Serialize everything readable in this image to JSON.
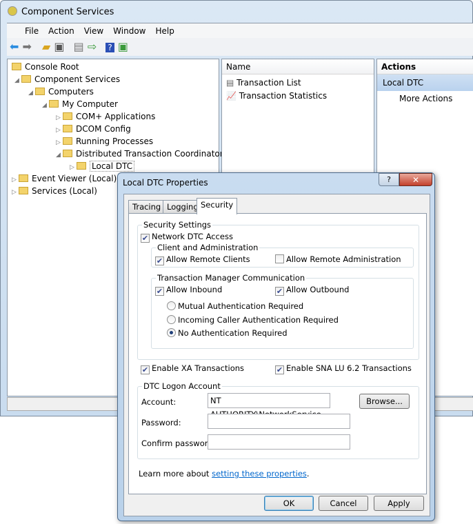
{
  "window": {
    "title": "Component Services"
  },
  "menu": [
    "File",
    "Action",
    "View",
    "Window",
    "Help"
  ],
  "tree": [
    {
      "label": "Console Root",
      "level": 0,
      "twisty": ""
    },
    {
      "label": "Component Services",
      "level": 1,
      "twisty": "▲"
    },
    {
      "label": "Computers",
      "level": 2,
      "twisty": "▲"
    },
    {
      "label": "My Computer",
      "level": 3,
      "twisty": "▲"
    },
    {
      "label": "COM+ Applications",
      "level": 4,
      "twisty": "▷"
    },
    {
      "label": "DCOM Config",
      "level": 4,
      "twisty": "▷"
    },
    {
      "label": "Running Processes",
      "level": 4,
      "twisty": "▷"
    },
    {
      "label": "Distributed Transaction Coordinator",
      "level": 4,
      "twisty": "▲"
    },
    {
      "label": "Local DTC",
      "level": 5,
      "twisty": "▷"
    },
    {
      "label": "Event Viewer (Local)",
      "level": 0,
      "twisty": "▷"
    },
    {
      "label": "Services (Local)",
      "level": 0,
      "twisty": "▷"
    }
  ],
  "list": {
    "header": "Name",
    "items": [
      "Transaction List",
      "Transaction Statistics"
    ]
  },
  "actions": {
    "header": "Actions",
    "selected": "Local DTC",
    "items": [
      "More Actions"
    ]
  },
  "dialog": {
    "title": "Local DTC Properties",
    "tabs": [
      "Tracing",
      "Logging",
      "Security"
    ],
    "security_settings": "Security Settings",
    "network_dtc_access": "Network DTC Access",
    "client_admin": "Client and Administration",
    "allow_remote_clients": "Allow Remote Clients",
    "allow_remote_admin": "Allow Remote Administration",
    "tm_comm": "Transaction Manager Communication",
    "allow_inbound": "Allow Inbound",
    "allow_outbound": "Allow Outbound",
    "radio_mutual": "Mutual Authentication Required",
    "radio_incoming": "Incoming Caller Authentication Required",
    "radio_none": "No Authentication Required",
    "enable_xa": "Enable XA Transactions",
    "enable_sna": "Enable SNA LU 6.2 Transactions",
    "logon_account": "DTC Logon Account",
    "account_label": "Account:",
    "account_value": "NT AUTHORITY\\NetworkService",
    "browse": "Browse...",
    "password_label": "Password:",
    "confirm_label": "Confirm password:",
    "learn_more": "Learn more about ",
    "learn_link": "setting these properties",
    "period": ".",
    "ok": "OK",
    "cancel": "Cancel",
    "apply": "Apply"
  }
}
